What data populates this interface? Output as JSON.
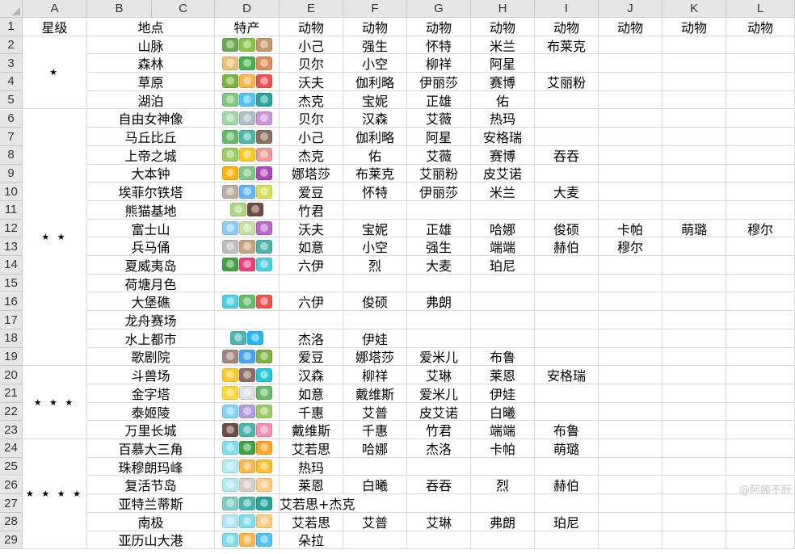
{
  "columns": [
    "A",
    "B",
    "C",
    "D",
    "E",
    "F",
    "G",
    "H",
    "I",
    "J",
    "K",
    "L"
  ],
  "header_row": {
    "rating": "星级",
    "location": "地点",
    "specialty": "特产",
    "animal_labels": [
      "动物",
      "动物",
      "动物",
      "动物",
      "动物",
      "动物",
      "动物",
      "动物"
    ]
  },
  "star_groups": [
    {
      "stars": "★",
      "rows": [
        2,
        5
      ]
    },
    {
      "stars": "★ ★",
      "rows": [
        6,
        19
      ]
    },
    {
      "stars": "★ ★ ★",
      "rows": [
        20,
        23
      ]
    },
    {
      "stars": "★ ★ ★ ★",
      "rows": [
        24,
        29
      ]
    }
  ],
  "rows": [
    {
      "n": "2",
      "loc": "山脉",
      "icons": [
        "#6aa84f",
        "#8bc34a",
        "#c49a6c"
      ],
      "animals": [
        "小己",
        "强生",
        "怀特",
        "米兰",
        "布莱克"
      ]
    },
    {
      "n": "3",
      "loc": "森林",
      "icons": [
        "#e8c07a",
        "#4caf50",
        "#d98f5c"
      ],
      "animals": [
        "贝尔",
        "小空",
        "柳祥",
        "阿星"
      ]
    },
    {
      "n": "4",
      "loc": "草原",
      "icons": [
        "#7cb342",
        "#ffb74d",
        "#ef5350"
      ],
      "animals": [
        "沃夫",
        "伽利略",
        "伊丽莎",
        "赛博",
        "艾丽粉"
      ]
    },
    {
      "n": "5",
      "loc": "湖泊",
      "icons": [
        "#81c784",
        "#4fc3f7",
        "#26a69a"
      ],
      "animals": [
        "杰克",
        "宝妮",
        "正雄",
        "佑"
      ]
    },
    {
      "n": "6",
      "loc": "自由女神像",
      "icons": [
        "#a5d6a7",
        "#b0bec5",
        "#ce93d8"
      ],
      "animals": [
        "贝尔",
        "汉森",
        "艾薇",
        "热玛"
      ]
    },
    {
      "n": "7",
      "loc": "马丘比丘",
      "icons": [
        "#66bb6a",
        "#4db6ac",
        "#8d6e63"
      ],
      "animals": [
        "小己",
        "伽利略",
        "阿星",
        "安格瑞"
      ]
    },
    {
      "n": "8",
      "loc": "上帝之城",
      "icons": [
        "#9ccc65",
        "#ffca28",
        "#ef9a9a"
      ],
      "animals": [
        "杰克",
        "佑",
        "艾薇",
        "赛博",
        "吞吞"
      ]
    },
    {
      "n": "9",
      "loc": "大本钟",
      "icons": [
        "#ffb300",
        "#81c784",
        "#ab47bc"
      ],
      "animals": [
        "娜塔莎",
        "布莱克",
        "艾丽粉",
        "皮艾诺"
      ]
    },
    {
      "n": "10",
      "loc": "埃菲尔铁塔",
      "icons": [
        "#bcaaa4",
        "#64b5f6",
        "#d4e157"
      ],
      "animals": [
        "爱豆",
        "怀特",
        "伊丽莎",
        "米兰",
        "大麦"
      ]
    },
    {
      "n": "11",
      "loc": "熊猫基地",
      "icons": [
        "#aed581",
        "#6d4c41"
      ],
      "animals": [
        "竹君"
      ]
    },
    {
      "n": "12",
      "loc": "富士山",
      "icons": [
        "#90caf9",
        "#c5e1a5",
        "#ba68c8"
      ],
      "animals": [
        "沃夫",
        "宝妮",
        "正雄",
        "哈娜",
        "俊硕",
        "卡帕",
        "萌璐",
        "穆尔"
      ]
    },
    {
      "n": "13",
      "loc": "兵马俑",
      "icons": [
        "#bdbdbd",
        "#c5a47e",
        "#4db6ac"
      ],
      "animals": [
        "如意",
        "小空",
        "强生",
        "端端",
        "赫伯",
        "穆尔"
      ]
    },
    {
      "n": "14",
      "loc": "夏威夷岛",
      "icons": [
        "#43a047",
        "#ec407a",
        "#4dd0e1"
      ],
      "animals": [
        "六伊",
        "烈",
        "大麦",
        "珀尼"
      ]
    },
    {
      "n": "15",
      "loc": "荷塘月色",
      "icons": [],
      "animals": []
    },
    {
      "n": "16",
      "loc": "大堡礁",
      "icons": [
        "#4dd0e1",
        "#66bb6a",
        "#ef5350"
      ],
      "animals": [
        "六伊",
        "俊硕",
        "弗朗"
      ]
    },
    {
      "n": "17",
      "loc": "龙舟赛场",
      "icons": [],
      "animals": []
    },
    {
      "n": "18",
      "loc": "水上都市",
      "icons": [
        "#4db6ac",
        "#29b6f6"
      ],
      "animals": [
        "杰洛",
        "伊娃"
      ]
    },
    {
      "n": "19",
      "loc": "歌剧院",
      "icons": [
        "#a1887f",
        "#42a5f5",
        "#7cb342"
      ],
      "animals": [
        "爱豆",
        "娜塔莎",
        "爱米儿",
        "布鲁"
      ]
    },
    {
      "n": "20",
      "loc": "斗兽场",
      "icons": [
        "#ffca28",
        "#8d6e63",
        "#26c6da"
      ],
      "animals": [
        "汉森",
        "柳祥",
        "艾琳",
        "莱恩",
        "安格瑞"
      ]
    },
    {
      "n": "21",
      "loc": "金字塔",
      "icons": [
        "#fdd835",
        "#e0e0e0",
        "#66bb6a"
      ],
      "animals": [
        "如意",
        "戴维斯",
        "爱米儿",
        "伊娃"
      ]
    },
    {
      "n": "22",
      "loc": "泰姬陵",
      "icons": [
        "#81d4fa",
        "#b39ddb",
        "#9ccc65"
      ],
      "animals": [
        "千惠",
        "艾普",
        "皮艾诺",
        "白曦"
      ]
    },
    {
      "n": "23",
      "loc": "万里长城",
      "icons": [
        "#6d4c41",
        "#4db6ac",
        "#f48fb1"
      ],
      "animals": [
        "戴维斯",
        "千惠",
        "竹君",
        "端端",
        "布鲁"
      ]
    },
    {
      "n": "24",
      "loc": "百慕大三角",
      "icons": [
        "#80deea",
        "#43a047",
        "#ffa726"
      ],
      "animals": [
        "艾若思",
        "哈娜",
        "杰洛",
        "卡帕",
        "萌璐"
      ]
    },
    {
      "n": "25",
      "loc": "珠穆朗玛峰",
      "icons": [
        "#b2ebf2",
        "#ffb74d",
        "#fbc02d"
      ],
      "animals": [
        "热玛"
      ]
    },
    {
      "n": "26",
      "loc": "复活节岛",
      "icons": [
        "#b2ebf2",
        "#d7ccc8",
        "#ffcc80"
      ],
      "animals": [
        "莱恩",
        "白曦",
        "吞吞",
        "烈",
        "赫伯"
      ]
    },
    {
      "n": "27",
      "loc": "亚特兰蒂斯",
      "icons": [
        "#80cbc4",
        "#4db6ac",
        "#26a69a"
      ],
      "note": "艾若思+杰克",
      "animals": []
    },
    {
      "n": "28",
      "loc": "南极",
      "icons": [
        "#b3e5fc",
        "#80deea",
        "#ffcc80"
      ],
      "animals": [
        "艾若思",
        "艾普",
        "艾琳",
        "弗朗",
        "珀尼"
      ]
    },
    {
      "n": "29",
      "loc": "亚历山大港",
      "icons": [
        "#80deea",
        "#ffb74d",
        "#4fc3f7"
      ],
      "animals": [
        "朵拉"
      ]
    }
  ],
  "watermark": "@阿娜不肝"
}
